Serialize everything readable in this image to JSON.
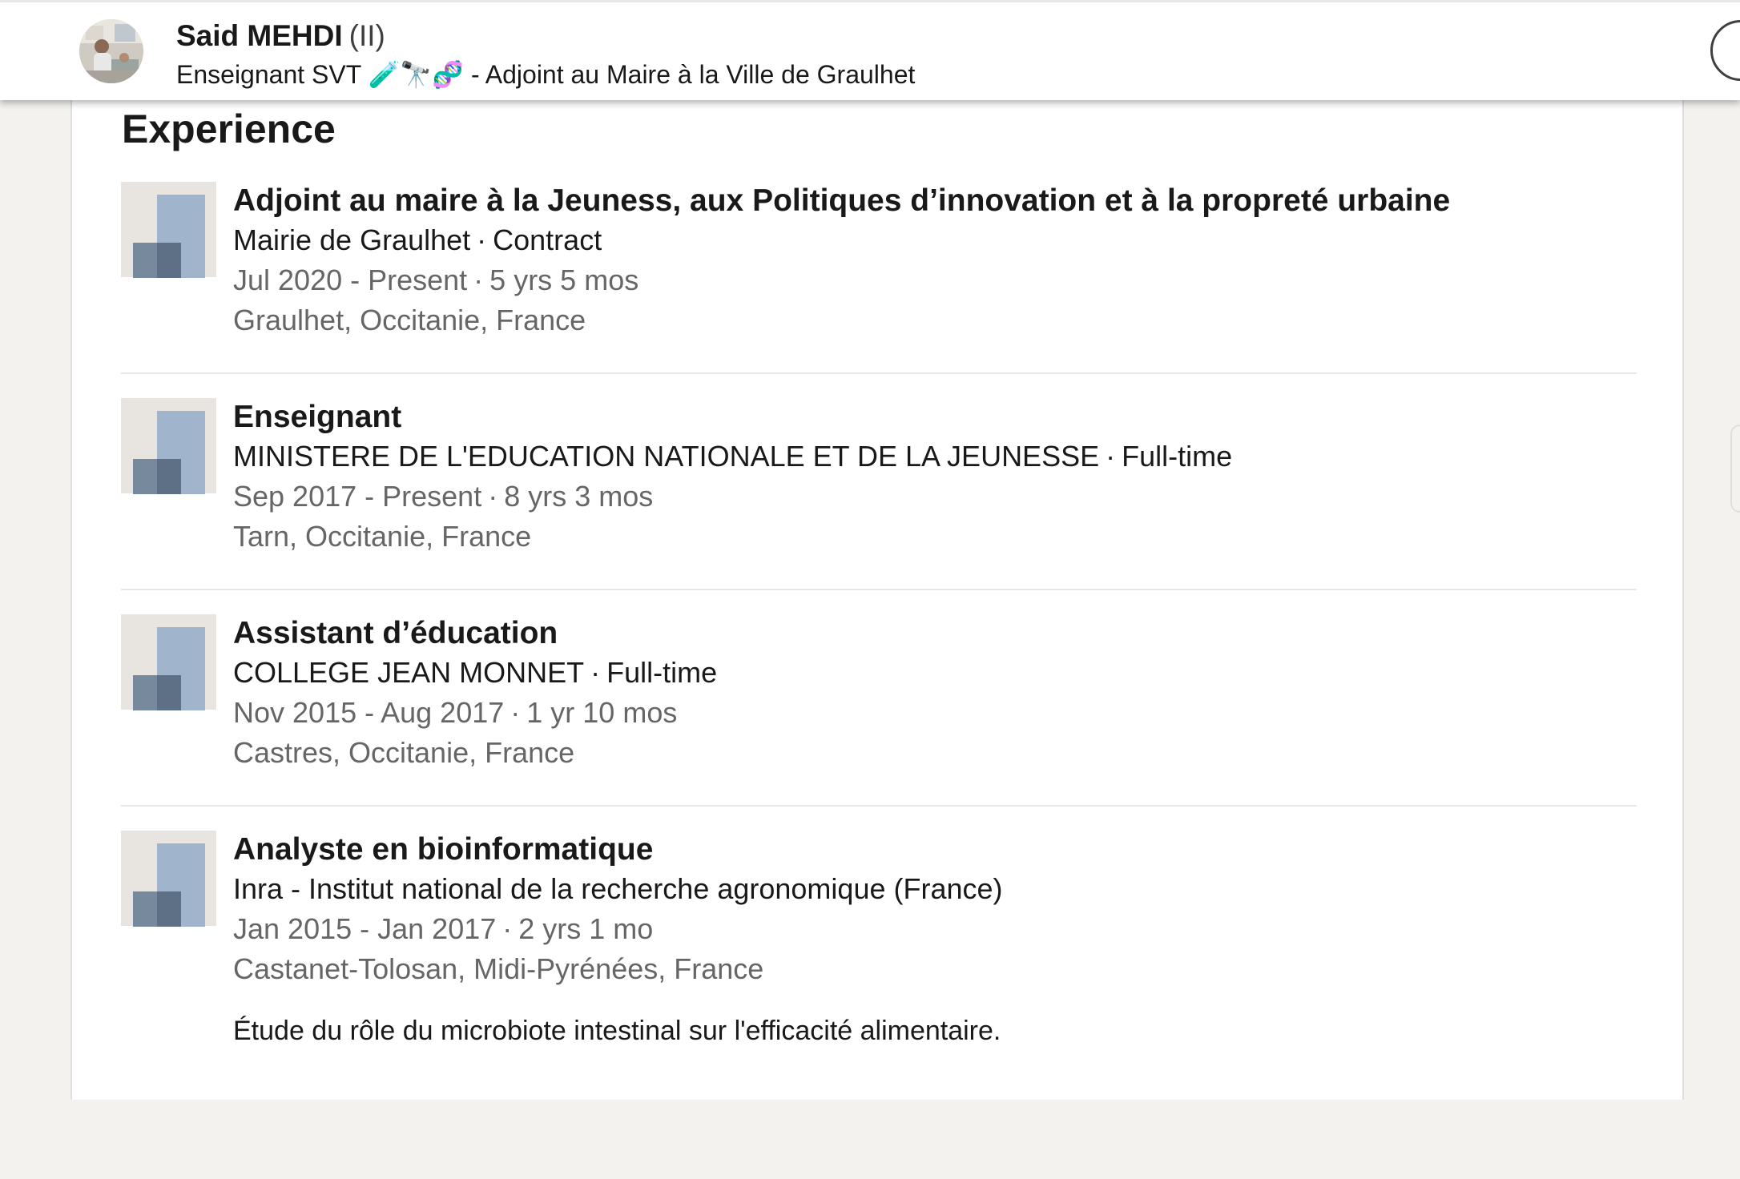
{
  "header": {
    "name": "Said MEHDI",
    "degree": "(II)",
    "headline": "Enseignant SVT 🧪🔭🧬 - Adjoint au Maire à la Ville de Graulhet"
  },
  "experience": {
    "title": "Experience",
    "items": [
      {
        "title": "Adjoint au maire à la Jeuness, aux Politiques d’innovation et à la propreté urbaine",
        "company": "Mairie de Graulhet",
        "employment_type": "Contract",
        "dates": "Jul 2020 - Present",
        "duration": "5 yrs 5 mos",
        "location": "Graulhet, Occitanie, France"
      },
      {
        "title": "Enseignant",
        "company": "MINISTERE DE L'EDUCATION NATIONALE ET DE LA JEUNESSE",
        "employment_type": "Full-time",
        "dates": "Sep 2017 - Present",
        "duration": "8 yrs 3 mos",
        "location": "Tarn, Occitanie, France"
      },
      {
        "title": "Assistant d’éducation",
        "company": "COLLEGE JEAN MONNET",
        "employment_type": "Full-time",
        "dates": "Nov 2015 - Aug 2017",
        "duration": "1 yr 10 mos",
        "location": "Castres, Occitanie, France"
      },
      {
        "title": "Analyste en bioinformatique",
        "company": "Inra - Institut national de la recherche agronomique (France)",
        "dates": "Jan 2015 - Jan 2017",
        "duration": "2 yrs 1 mo",
        "location": "Castanet-Tolosan, Midi-Pyrénées, France",
        "description": "Étude du rôle du microbiote intestinal sur l'efficacité alimentaire."
      }
    ]
  },
  "separator": "·",
  "icons": {
    "company_logo": "company-logo-placeholder-icon",
    "avatar": "profile-photo"
  }
}
